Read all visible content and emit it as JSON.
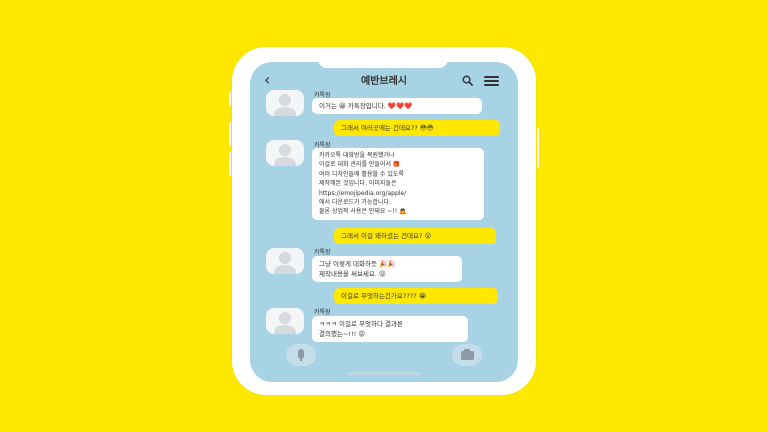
{
  "header": {
    "title": "예반브레시",
    "back_icon": "‹",
    "search_icon": "search-icon",
    "menu_icon": "menu-icon"
  },
  "messages": [
    {
      "type": "in",
      "sender": "카톡장",
      "text": "이거는 😀 카톡장입니다. ❤️❤️❤️"
    },
    {
      "type": "out",
      "text": "그래서 여러곳에는 건데요?? 😳😳"
    },
    {
      "type": "in",
      "sender": "카톡장",
      "text": "카카오톡 대화방을 복원했거나\n이걸로 대화 관리를 만들어서 🎁\n여러 디자인들에 활용할 수 있도록\n제작해본 것입니다. 이미지들은\nhttps://emojipedia.org/apple/\n에서 다운로드가 가능합니다.\n물론 상업적 사용은 안돼요 ~!! 🙇"
    },
    {
      "type": "out",
      "text": "그래서 이걸 왜하셨는 건데요? 😮"
    },
    {
      "type": "in",
      "sender": "카톡장",
      "text": "그냥 이렇게 대화하듯 🎉🎉\n제작내용을 써보세요. 😜"
    },
    {
      "type": "out",
      "text": "이걸로 무엇하는건가요???? 😭"
    },
    {
      "type": "in",
      "sender": "카톡장",
      "text": "ㅋㅋㅋ 이걸로 무엇하다 결과론\n결의했는~!!! 😝"
    }
  ],
  "bottom": {
    "mic_icon": "microphone-icon",
    "camera_icon": "camera-icon"
  },
  "colors": {
    "background": "#FFE800",
    "screen": "#A8D3E4",
    "outgoing_bubble": "#FFE800",
    "incoming_bubble": "#FFFFFF"
  }
}
